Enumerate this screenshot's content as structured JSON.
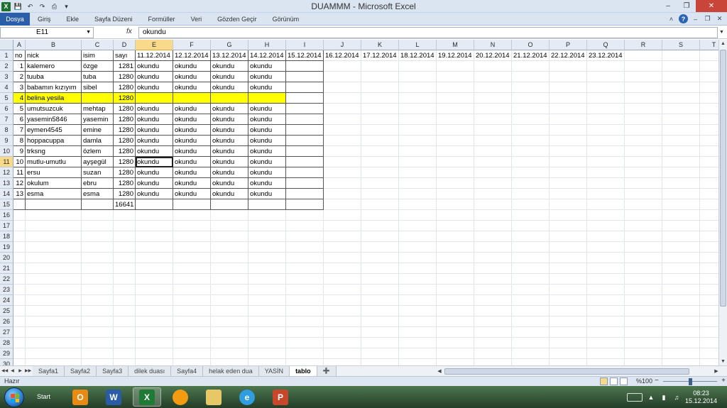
{
  "window": {
    "title": "DUAMMM  -  Microsoft Excel"
  },
  "ribbon": {
    "file_tab": "Dosya",
    "tabs": [
      "Giriş",
      "Ekle",
      "Sayfa Düzeni",
      "Formüller",
      "Veri",
      "Gözden Geçir",
      "Görünüm"
    ]
  },
  "formula_bar": {
    "name_box": "E11",
    "fx": "fx",
    "content": "okundu"
  },
  "columns": [
    "A",
    "B",
    "C",
    "D",
    "E",
    "F",
    "G",
    "H",
    "I",
    "J",
    "K",
    "L",
    "M",
    "N",
    "O",
    "P",
    "Q",
    "R",
    "S",
    "T"
  ],
  "selected": {
    "column": "E",
    "row": 11
  },
  "rows": [
    [
      "no",
      "nick",
      "isim",
      "sayı",
      "11.12.2014",
      "12.12.2014",
      "13.12.2014",
      "14.12.2014",
      "15.12.2014",
      "16.12.2014",
      "17.12.2014",
      "18.12.2014",
      "19.12.2014",
      "20.12.2014",
      "21.12.2014",
      "22.12.2014",
      "23.12.2014"
    ],
    [
      "1",
      "kalemero",
      "özge",
      "1281",
      "okundu",
      "okundu",
      "okundu",
      "okundu"
    ],
    [
      "2",
      "tuuba",
      "tuba",
      "1280",
      "okundu",
      "okundu",
      "okundu",
      "okundu"
    ],
    [
      "3",
      "babamın kızıyım",
      "sibel",
      "1280",
      "okundu",
      "okundu",
      "okundu",
      "okundu"
    ],
    [
      "4",
      "belina yesila",
      "",
      "1280",
      "",
      "",
      "",
      "",
      ""
    ],
    [
      "5",
      "umutsuzcuk",
      "mehtap",
      "1280",
      "okundu",
      "okundu",
      "okundu",
      "okundu"
    ],
    [
      "6",
      "yasemin5846",
      "yasemin",
      "1280",
      "okundu",
      "okundu",
      "okundu",
      "okundu"
    ],
    [
      "7",
      "eymen4545",
      "emine",
      "1280",
      "okundu",
      "okundu",
      "okundu",
      "okundu"
    ],
    [
      "8",
      "hoppacuppa",
      "damla",
      "1280",
      "okundu",
      "okundu",
      "okundu",
      "okundu"
    ],
    [
      "9",
      "trksng",
      "özlem",
      "1280",
      "okundu",
      "okundu",
      "okundu",
      "okundu"
    ],
    [
      "10",
      "mutlu-umutlu",
      "ayşegül",
      "1280",
      "okundu",
      "okundu",
      "okundu",
      "okundu"
    ],
    [
      "11",
      "ersu",
      "suzan",
      "1280",
      "okundu",
      "okundu",
      "okundu",
      "okundu"
    ],
    [
      "12",
      "okulum",
      "ebru",
      "1280",
      "okundu",
      "okundu",
      "okundu",
      "okundu"
    ],
    [
      "13",
      "esma",
      "esma",
      "1280",
      "okundu",
      "okundu",
      "okundu",
      "okundu"
    ],
    [
      "",
      "",
      "",
      "16641"
    ]
  ],
  "highlight_color": "#ffff00",
  "row_count": 30,
  "sheet_tabs": [
    "Sayfa1",
    "Sayfa2",
    "Sayfa3",
    "dilek duası",
    "Sayfa4",
    "helak eden dua",
    "YASİN",
    "tablo"
  ],
  "active_sheet": "tablo",
  "status": {
    "ready": "Hazır",
    "zoom": "%100"
  },
  "taskbar": {
    "start_label": "Start",
    "apps": [
      "outlook-icon",
      "word-icon",
      "excel-icon",
      "media-icon",
      "explorer-folder-icon",
      "ie-icon",
      "powerpoint-icon"
    ],
    "time": "08:23",
    "date": "15.12.2014"
  }
}
